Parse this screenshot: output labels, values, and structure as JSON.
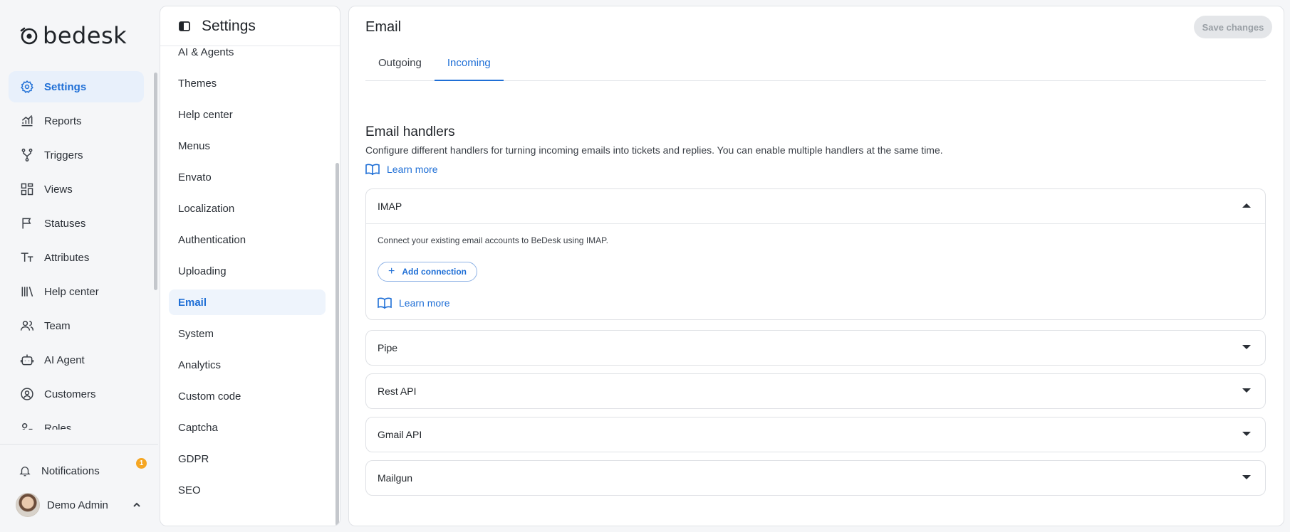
{
  "brand": {
    "name": "bedesk"
  },
  "nav": {
    "items": [
      {
        "label": "Settings",
        "icon": "gear-icon",
        "active": true
      },
      {
        "label": "Reports",
        "icon": "chart-icon"
      },
      {
        "label": "Triggers",
        "icon": "trigger-icon"
      },
      {
        "label": "Views",
        "icon": "views-icon"
      },
      {
        "label": "Statuses",
        "icon": "flag-icon"
      },
      {
        "label": "Attributes",
        "icon": "text-icon"
      },
      {
        "label": "Help center",
        "icon": "library-icon"
      },
      {
        "label": "Team",
        "icon": "team-icon"
      },
      {
        "label": "AI Agent",
        "icon": "bot-icon"
      },
      {
        "label": "Customers",
        "icon": "customer-icon"
      },
      {
        "label": "Roles",
        "icon": "roles-icon"
      }
    ],
    "notifications": {
      "label": "Notifications",
      "count": "1"
    },
    "user": {
      "name": "Demo Admin"
    }
  },
  "settings": {
    "title": "Settings",
    "items": [
      "AI & Agents",
      "Themes",
      "Help center",
      "Menus",
      "Envato",
      "Localization",
      "Authentication",
      "Uploading",
      "Email",
      "System",
      "Analytics",
      "Custom code",
      "Captcha",
      "GDPR",
      "SEO"
    ],
    "active": "Email"
  },
  "main": {
    "title": "Email",
    "save_label": "Save changes",
    "tabs": [
      {
        "label": "Outgoing",
        "active": false
      },
      {
        "label": "Incoming",
        "active": true
      }
    ],
    "section": {
      "title": "Email handlers",
      "description": "Configure different handlers for turning incoming emails into tickets and replies. You can enable multiple handlers at the same time.",
      "learn_more": "Learn more"
    },
    "handlers": {
      "imap": {
        "name": "IMAP",
        "description": "Connect your existing email accounts to BeDesk using IMAP.",
        "add_label": "Add connection",
        "learn_more": "Learn more"
      },
      "others": [
        "Pipe",
        "Rest API",
        "Gmail API",
        "Mailgun"
      ]
    }
  },
  "colors": {
    "accent": "#1f6fd6",
    "badge": "#f5a623"
  }
}
